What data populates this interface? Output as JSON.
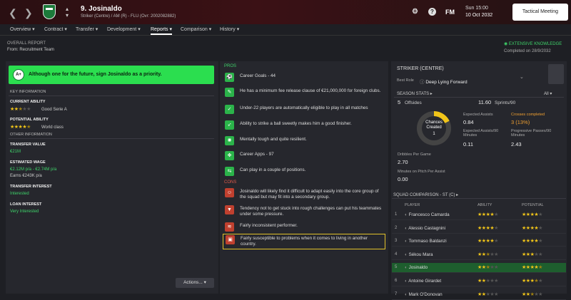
{
  "player": {
    "name": "9. Josinaldo",
    "subtitle": "Striker (Centre) / AM (R) - FLU (Ovr: 2002082882)"
  },
  "header": {
    "fm_label": "FM",
    "day": "Sun 15:00",
    "date": "10 Oct 2032",
    "tactical_meeting": "Tactical Meeting",
    "back_icon": "chevron-left-icon",
    "forward_icon": "chevron-right-icon"
  },
  "tabs": [
    {
      "label": "Overview",
      "caret": "▾"
    },
    {
      "label": "Contract",
      "caret": "▾"
    },
    {
      "label": "Transfer",
      "caret": "▾"
    },
    {
      "label": "Development",
      "caret": "▾"
    },
    {
      "label": "Reports",
      "caret": "▾"
    },
    {
      "label": "Comparison",
      "caret": "▾"
    },
    {
      "label": "History",
      "caret": "▾"
    }
  ],
  "report": {
    "title": "OVERALL REPORT",
    "from": "From: Recruitment Team",
    "knowledge": "EXTENSIVE KNOWLEDGE",
    "completed": "Completed on 28/9/2032"
  },
  "verdict": {
    "grade": "A+",
    "text": "Although one for the future, sign Josinaldo as a priority."
  },
  "key_info": {
    "title": "KEY INFORMATION",
    "current_ability_label": "CURRENT ABILITY",
    "current_ability_note": "Good Serie A",
    "current_ability_stars": 2.5,
    "potential_label": "POTENTIAL ABILITY",
    "potential_note": "World class",
    "potential_stars": 4.5,
    "other_title": "OTHER INFORMATION",
    "transfer_value_label": "TRANSFER VALUE",
    "transfer_value": "€21M",
    "wage_label": "ESTIMATED WAGE",
    "wage_value": "€2.12M p/a - €2.74M p/a",
    "wage_current": "Earns €243K p/a",
    "transfer_interest_label": "TRANSFER INTEREST",
    "transfer_interest": "Interested",
    "loan_interest_label": "LOAN INTEREST",
    "loan_interest": "Very Interested"
  },
  "actions_label": "Actions...",
  "pros_title": "PROS",
  "pros": [
    {
      "text": "Career Goals - 44",
      "icon": "football-icon"
    },
    {
      "text": "He has a minimum fee release clause of €21,000,000 for foreign clubs.",
      "icon": "contract-icon"
    },
    {
      "text": "Under-22 players are automatically eligible to play in all matches",
      "icon": "checklist-icon"
    },
    {
      "text": "Ability to strike a ball sweetly makes him a good finisher.",
      "icon": "boot-icon"
    },
    {
      "text": "Mentally tough and quite resilient.",
      "icon": "brain-icon"
    },
    {
      "text": "Career Apps - 97",
      "icon": "arrows-icon"
    },
    {
      "text": "Can play in a couple of positions.",
      "icon": "positions-icon"
    }
  ],
  "cons_title": "CONS",
  "cons": [
    {
      "text": "Josinaldo will likely find it difficult to adapt easily into the core group of the squad but may fit into a secondary group.",
      "icon": "group-icon"
    },
    {
      "text": "Tendency not to get stuck into rough challenges can put his teammates under some pressure.",
      "icon": "shield-icon"
    },
    {
      "text": "Fairly inconsistent performer.",
      "icon": "chart-icon"
    },
    {
      "text": "Fairly susceptible to problems when it comes to living in another country.",
      "icon": "suitcase-icon"
    }
  ],
  "role": {
    "position": "STRIKER (CENTRE)",
    "best_role_label": "Best Role",
    "best_role": "Deep Lying Forward"
  },
  "season_stats": {
    "title": "SEASON STATS",
    "filter": "All",
    "offsides_value": "5",
    "offsides_label": "Offsides",
    "sprints_value": "11.60",
    "sprints_label": "Sprints/90",
    "wheel_label": "Chances Created",
    "wheel_value": "1",
    "expected_assists_label": "Expected Assists",
    "expected_assists": "0.84",
    "crosses_label": "Crosses completed",
    "crosses": "3 (13%)",
    "xa90_label": "Expected Assists/90 Minutes",
    "xa90": "0.11",
    "prog_label": "Progressive Passes/90 Minutes",
    "prog": "2.43",
    "dribbles_label": "Dribbles Per Game",
    "dribbles": "2.70",
    "minutes_label": "Minutes on Pitch Per Assist",
    "minutes": "0.00"
  },
  "squad": {
    "title": "SQUAD COMPARISON - ST (C)",
    "col_player": "PLAYER",
    "col_ability": "ABILITY",
    "col_potential": "POTENTIAL",
    "rows": [
      {
        "n": "1",
        "name": "Francesco Camarda",
        "ability": 4,
        "potential": 4
      },
      {
        "n": "2",
        "name": "Alessio Castagnini",
        "ability": 4,
        "potential": 4
      },
      {
        "n": "3",
        "name": "Tommaso Baldanzi",
        "ability": 4,
        "potential": 4
      },
      {
        "n": "4",
        "name": "Sékou Mara",
        "ability": 2.5,
        "potential": 3
      },
      {
        "n": "5",
        "name": "Josinaldo",
        "ability": 2.5,
        "potential": 4.5
      },
      {
        "n": "6",
        "name": "Antoine Girardet",
        "ability": 2,
        "potential": 3.5
      },
      {
        "n": "7",
        "name": "Mark O'Donovan",
        "ability": 2,
        "potential": 2.5
      }
    ]
  },
  "colors": {
    "accent_green": "#2bde4f",
    "star_gold": "#f0c419",
    "con_red": "#c0402f",
    "highlight_border": "#e2c22a"
  }
}
